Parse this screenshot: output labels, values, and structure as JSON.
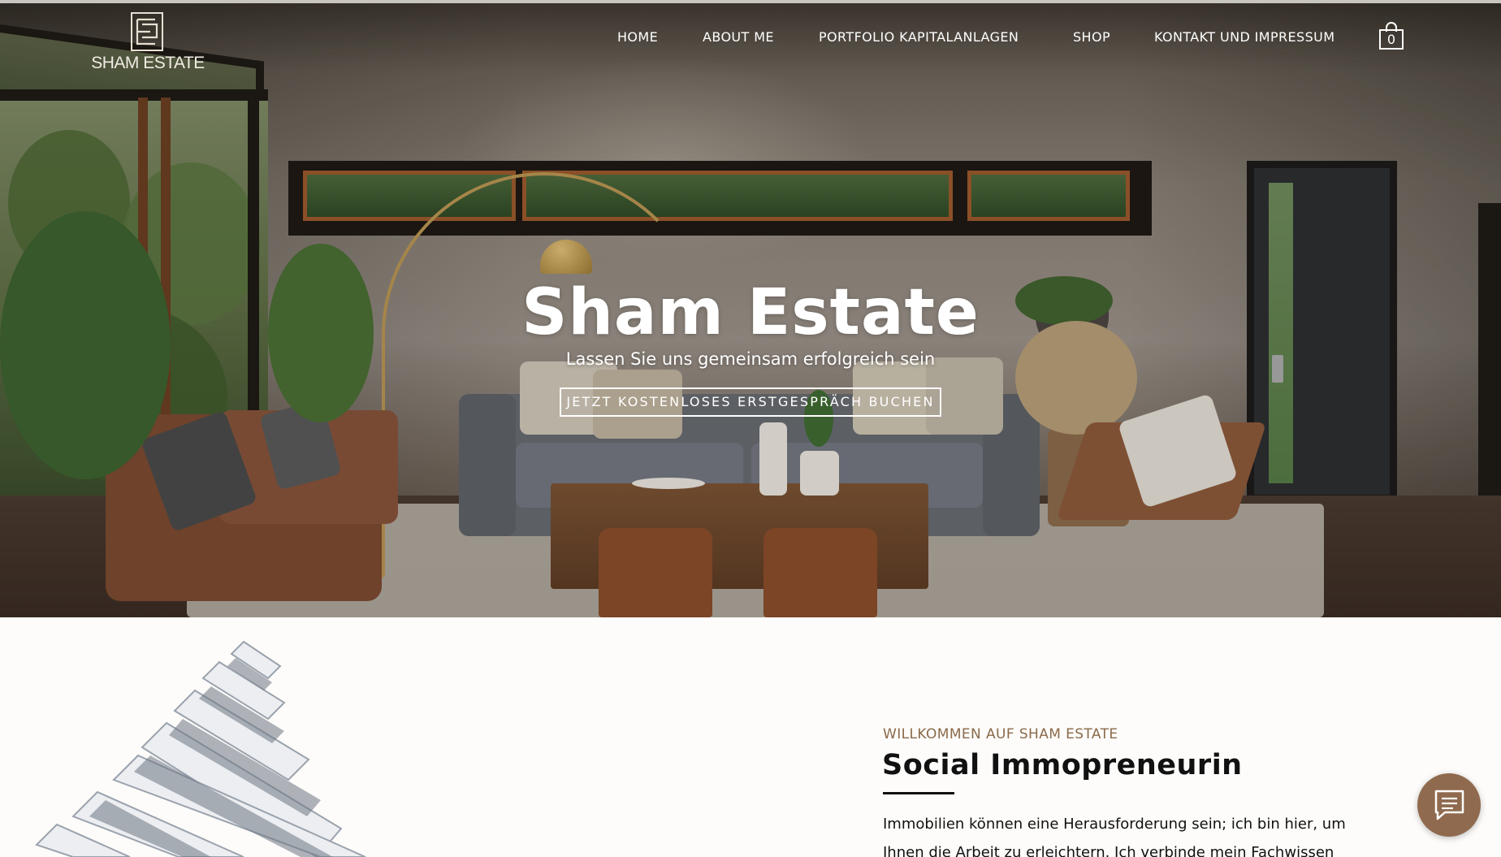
{
  "brand": {
    "logo_text": "SHAM ESTATE",
    "accent": "#8f6a4e"
  },
  "nav": {
    "items": [
      {
        "label": "HOME"
      },
      {
        "label": "ABOUT ME"
      },
      {
        "label": "PORTFOLIO KAPITALANLAGEN"
      },
      {
        "label": "SHOP"
      },
      {
        "label": "KONTAKT UND IMPRESSUM"
      }
    ],
    "cart_count": "0"
  },
  "hero": {
    "title": "Sham Estate",
    "subtitle": "Lassen Sie uns gemeinsam erfolgreich sein",
    "cta_label": "JETZT KOSTENLOSES ERSTGESPRÄCH BUCHEN"
  },
  "intro": {
    "eyebrow": "WILLKOMMEN AUF SHAM ESTATE",
    "heading": "Social Immopreneurin",
    "paragraph": "Immobilien können eine Herausforderung sein; ich bin hier, um Ihnen die Arbeit zu erleichtern. Ich verbinde mein Fachwissen"
  },
  "icons": {
    "cart": "shopping-bag-icon",
    "chat": "chat-icon",
    "logo": "logo-monogram-icon"
  }
}
